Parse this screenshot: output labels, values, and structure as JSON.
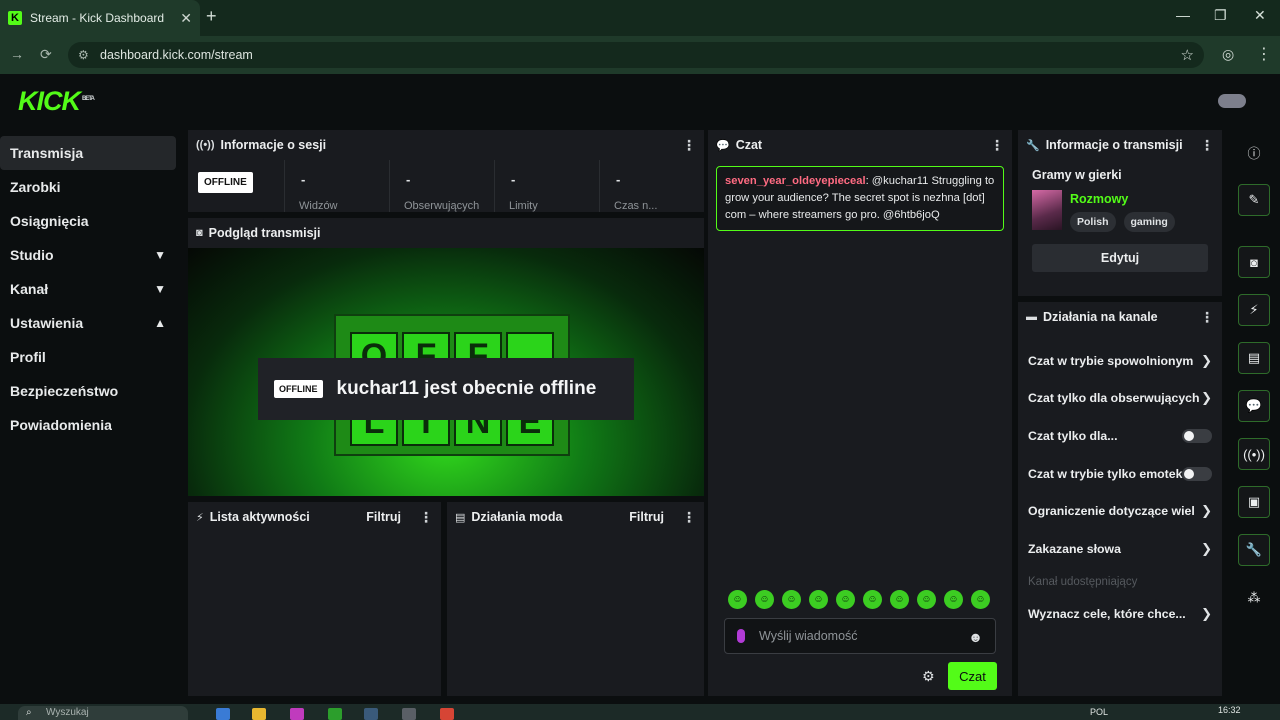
{
  "browser": {
    "tab_title": "Stream - Kick Dashboard",
    "tab_favicon": "K",
    "url": "dashboard.kick.com/stream"
  },
  "header": {
    "logo": "KICK",
    "logo_sup": "BETA"
  },
  "sidebar": {
    "items": [
      {
        "label": "Transmisja"
      },
      {
        "label": "Zarobki"
      },
      {
        "label": "Osiągnięcia"
      },
      {
        "label": "Studio"
      },
      {
        "label": "Kanał"
      },
      {
        "label": "Ustawienia"
      },
      {
        "label": "Profil"
      },
      {
        "label": "Bezpieczeństwo"
      },
      {
        "label": "Powiadomienia"
      }
    ]
  },
  "session": {
    "title": "Informacje o sesji",
    "badge": "OFFLINE",
    "stats": [
      {
        "value": "-",
        "label": "Widzów"
      },
      {
        "value": "-",
        "label": "Obserwujących"
      },
      {
        "value": "-",
        "label": "Limity"
      },
      {
        "value": "-",
        "label": "Czas n..."
      }
    ]
  },
  "preview": {
    "title": "Podgląd transmisji",
    "badge": "OFFLINE",
    "message": "kuchar11 jest obecnie offline",
    "screen_top": [
      "O",
      "F",
      "F",
      "."
    ],
    "screen_bottom": [
      "L",
      "I",
      "N",
      "E"
    ]
  },
  "activity": {
    "title": "Lista aktywności",
    "filter": "Filtruj"
  },
  "mod": {
    "title": "Działania moda",
    "filter": "Filtruj"
  },
  "chat": {
    "title": "Czat",
    "message": {
      "user": "seven_year_oldeyepieceal",
      "text": "@kuchar11 Struggling to grow your audience? The secret spot is nezhna [dot] com – where streamers go pro. @6htb6joQ"
    },
    "input_placeholder": "Wyślij wiadomość",
    "send_label": "Czat"
  },
  "stream_info": {
    "title": "Informacje o transmisji",
    "category": "Gramy w gierki",
    "game": "Rozmowy",
    "tags": [
      "Polish",
      "gaming"
    ],
    "edit_label": "Edytuj"
  },
  "channel_actions": {
    "title": "Działania na kanale",
    "items": [
      {
        "label": "Czat w trybie spowolnionym"
      },
      {
        "label": "Czat tylko dla obserwujących"
      },
      {
        "label": "Czat tylko dla..."
      },
      {
        "label": "Czat w trybie tylko emotek"
      },
      {
        "label": "Ograniczenie dotyczące wiel"
      },
      {
        "label": "Zakazane słowa"
      },
      {
        "label": "Kanał udostępniający"
      },
      {
        "label": "Wyznacz cele, które chce..."
      }
    ]
  },
  "taskbar": {
    "search": "Wyszukaj",
    "lang": "POL",
    "time": "16:32"
  },
  "colors": {
    "accent": "#53fc18",
    "panel": "#191b1f",
    "background": "#0b0e0f"
  }
}
